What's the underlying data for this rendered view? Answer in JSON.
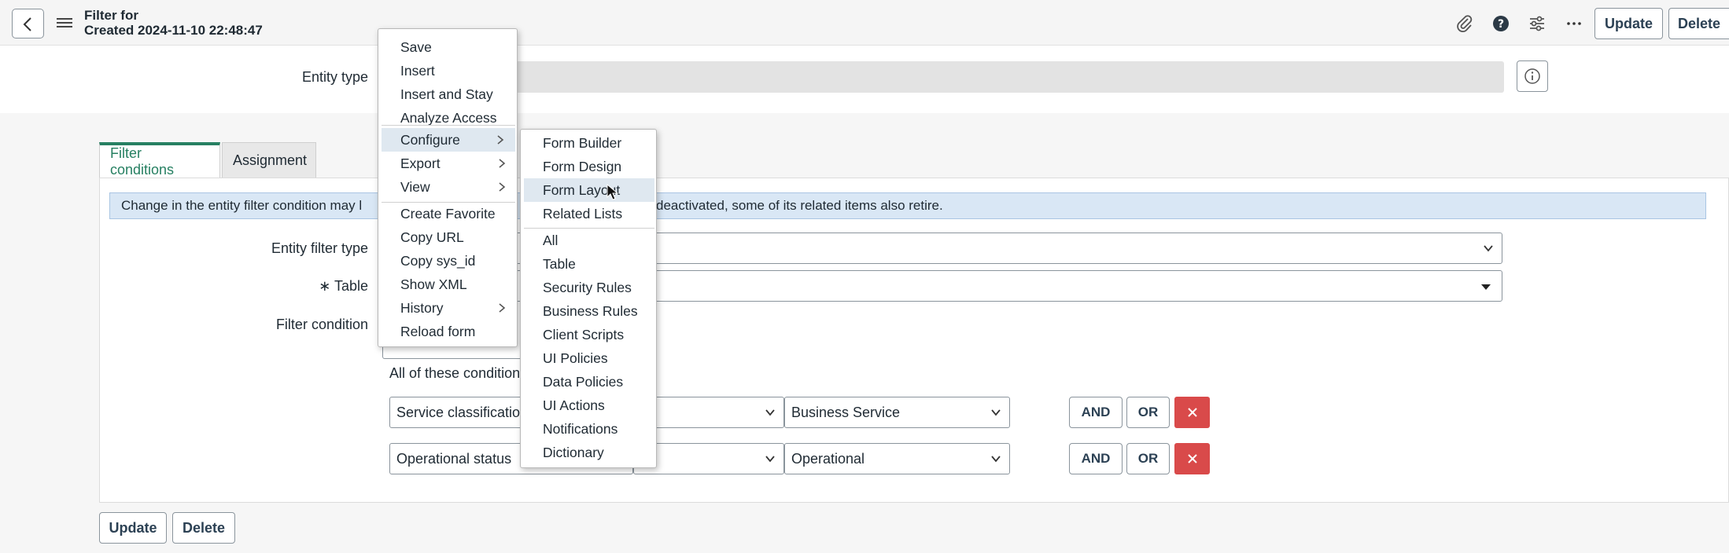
{
  "header": {
    "title_line1": "Filter for",
    "title_line2": "Created 2024-11-10 22:48:47",
    "update_label": "Update",
    "delete_label": "Delete"
  },
  "form": {
    "entity_type_label": "Entity type",
    "tabs": [
      {
        "label": "Filter conditions"
      },
      {
        "label": "Assignment"
      }
    ],
    "notice_left": "Change in the entity filter condition may l",
    "notice_right": "deactivated, some of its related items also retire.",
    "entity_filter_type_label": "Entity filter type",
    "table_required": "∗",
    "table_label": "Table",
    "filter_condition_label": "Filter condition",
    "all_conditions_text": "All of these condition",
    "conditions": [
      {
        "field": "Service classification",
        "value": "Business Service"
      },
      {
        "field": "Operational status",
        "value": "Operational"
      }
    ],
    "and_label": "AND",
    "or_label": "OR",
    "footer_update": "Update",
    "footer_delete": "Delete"
  },
  "context_menu": {
    "items": [
      {
        "label": "Save"
      },
      {
        "label": "Insert"
      },
      {
        "label": "Insert and Stay"
      },
      {
        "label": "Analyze Access"
      },
      {
        "label": "Configure"
      },
      {
        "label": "Export"
      },
      {
        "label": "View"
      },
      {
        "label": "Create Favorite"
      },
      {
        "label": "Copy URL"
      },
      {
        "label": "Copy sys_id"
      },
      {
        "label": "Show XML"
      },
      {
        "label": "History"
      },
      {
        "label": "Reload form"
      }
    ]
  },
  "configure_submenu": {
    "items": [
      {
        "label": "Form Builder"
      },
      {
        "label": "Form Design"
      },
      {
        "label": "Form Layout"
      },
      {
        "label": "Related Lists"
      },
      {
        "label": "All"
      },
      {
        "label": "Table"
      },
      {
        "label": "Security Rules"
      },
      {
        "label": "Business Rules"
      },
      {
        "label": "Client Scripts"
      },
      {
        "label": "UI Policies"
      },
      {
        "label": "Data Policies"
      },
      {
        "label": "UI Actions"
      },
      {
        "label": "Notifications"
      },
      {
        "label": "Dictionary"
      }
    ]
  },
  "colors": {
    "accent_green": "#278062",
    "notice_bg": "#d9e7f5",
    "delete_red": "#d94a4a",
    "menu_highlight": "#dfe8f0"
  }
}
